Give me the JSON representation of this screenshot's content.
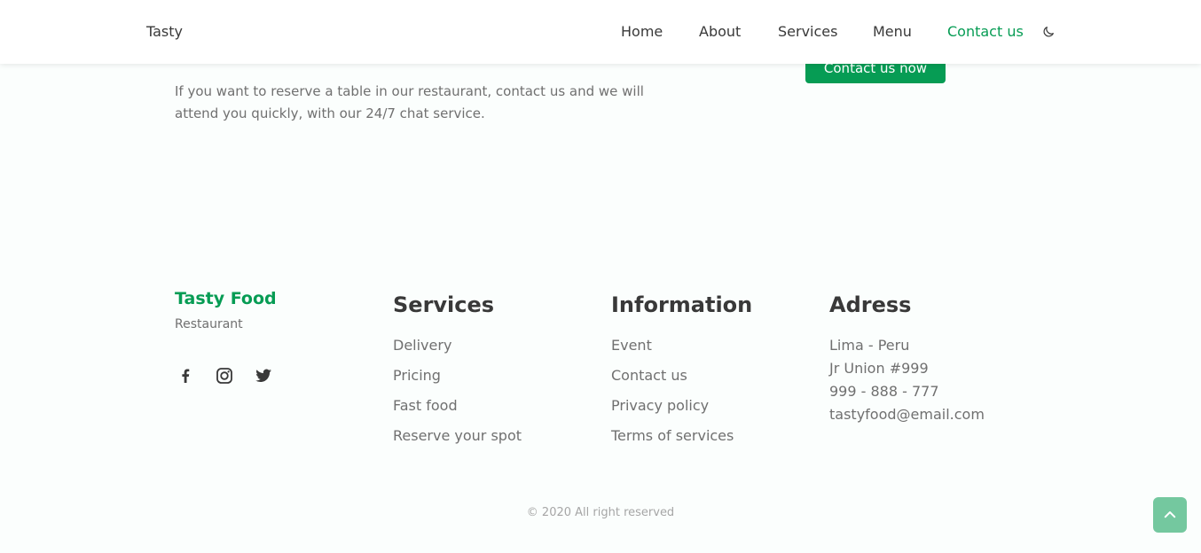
{
  "header": {
    "brand": "Tasty",
    "nav": [
      {
        "label": "Home",
        "active": false
      },
      {
        "label": "About",
        "active": false
      },
      {
        "label": "Services",
        "active": false
      },
      {
        "label": "Menu",
        "active": false
      },
      {
        "label": "Contact us",
        "active": true
      }
    ],
    "theme_toggle_icon": "moon-icon"
  },
  "contact": {
    "text": "If you want to reserve a table in our restaurant, contact us and we will attend you quickly, with our 24/7 chat service.",
    "button_label": "Contact us now"
  },
  "footer": {
    "brand": "Tasty Food",
    "subtitle": "Restaurant",
    "social_icons": [
      "facebook-icon",
      "instagram-icon",
      "twitter-icon"
    ],
    "services": {
      "title": "Services",
      "items": [
        "Delivery",
        "Pricing",
        "Fast food",
        "Reserve your spot"
      ]
    },
    "information": {
      "title": "Information",
      "items": [
        "Event",
        "Contact us",
        "Privacy policy",
        "Terms of services"
      ]
    },
    "address": {
      "title": "Adress",
      "lines": [
        "Lima - Peru",
        "Jr Union #999",
        "999 - 888 - 777",
        "tastyfood@email.com"
      ]
    },
    "copyright": "© 2020 All right reserved"
  },
  "scroll_top_icon": "chevron-up-icon",
  "colors": {
    "accent": "#069c54",
    "text": "#393939",
    "text_light": "#707070",
    "background": "#fbfefd"
  }
}
